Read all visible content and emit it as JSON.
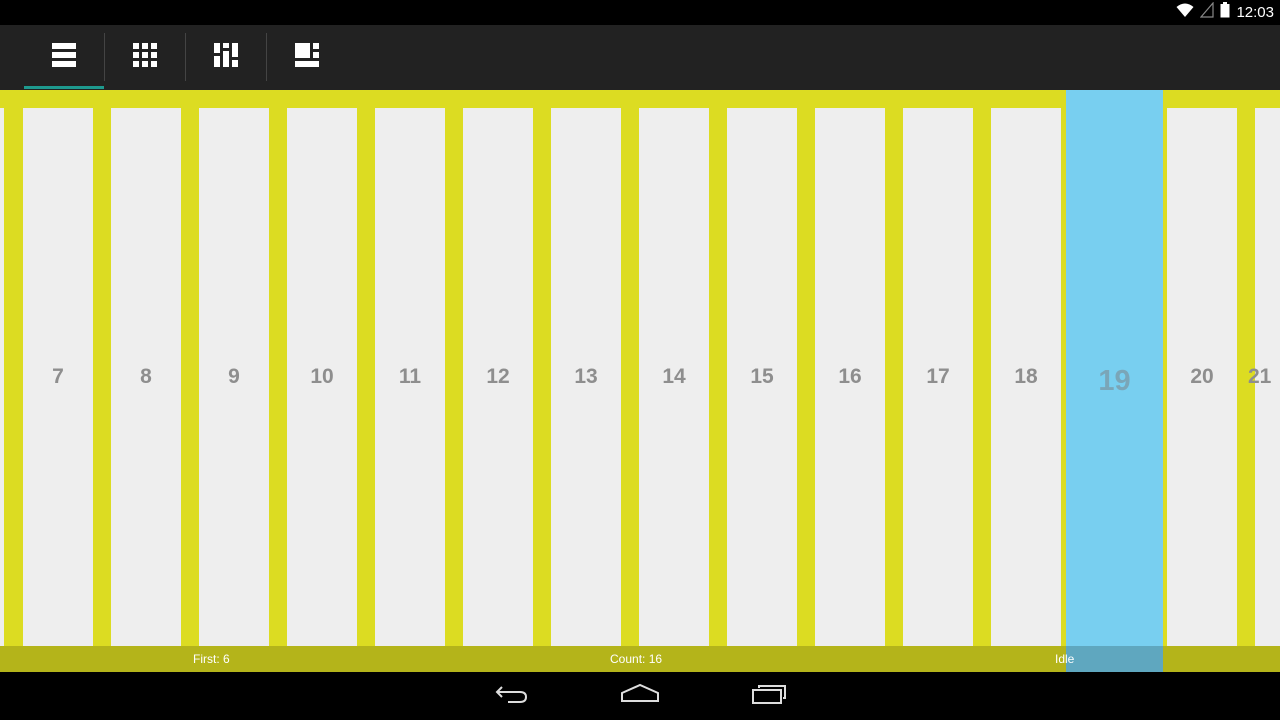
{
  "status_bar": {
    "time": "12:03",
    "icons": [
      "wifi-icon",
      "signal-icon",
      "battery-icon"
    ]
  },
  "toolbar": {
    "tabs": [
      {
        "name": "list-layout",
        "icon": "list-icon",
        "active": true
      },
      {
        "name": "grid-layout",
        "icon": "grid-icon",
        "active": false
      },
      {
        "name": "staggered-layout",
        "icon": "staggered-grid-icon",
        "active": false
      },
      {
        "name": "spannable-layout",
        "icon": "spannable-grid-icon",
        "active": false
      }
    ],
    "accent_color": "#1e9a8f"
  },
  "content": {
    "background_color": "#dcdc22",
    "items": [
      "7",
      "8",
      "9",
      "10",
      "11",
      "12",
      "13",
      "14",
      "15",
      "16",
      "17",
      "18",
      "19",
      "20",
      "21"
    ],
    "selected_item": "19",
    "selected_color": "#78cff0"
  },
  "footer": {
    "first": "First: 6",
    "count": "Count: 16",
    "state": "Idle"
  },
  "nav_bar": {
    "buttons": [
      "back-icon",
      "home-icon",
      "recents-icon"
    ]
  }
}
